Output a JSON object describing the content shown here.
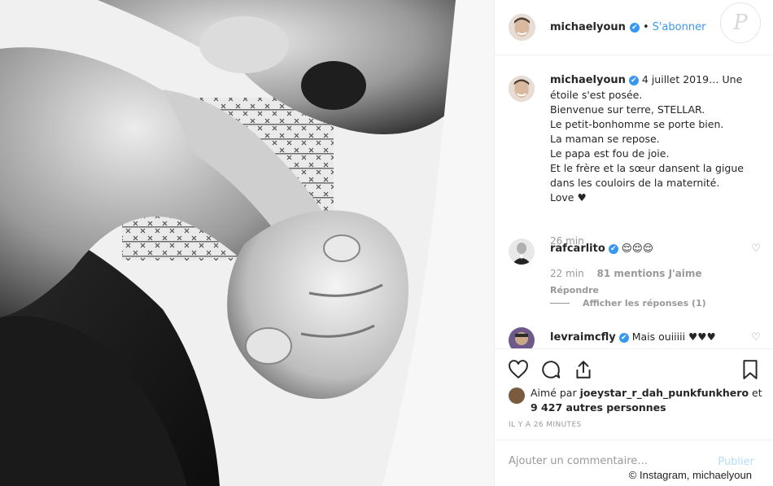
{
  "post": {
    "username": "michaelyoun",
    "follow_label": "S'abonner",
    "separator": "•",
    "verified_glyph": "✔",
    "watermark_letter": "P",
    "caption_lines": [
      "4 juillet 2019… Une",
      "étoile s'est posée.",
      "Bienvenue sur terre, STELLAR.",
      "Le petit-bonhomme se porte bien.",
      "La maman se repose.",
      "Le papa est fou de joie.",
      "Et le frère et la sœur dansent la gigue",
      "dans les couloirs de la maternité.",
      "Love ♥"
    ],
    "caption_time": "26 min"
  },
  "comments": [
    {
      "username": "rafcarlito",
      "text": "😌😌😌",
      "time": "22 min",
      "likes": "81 mentions J'aime",
      "reply_label": "Répondre",
      "view_replies": "Afficher les réponses (1)"
    },
    {
      "username": "levraimcfly",
      "text": "Mais ouiiiii ♥♥♥"
    }
  ],
  "likes": {
    "prefix": "Aimé par",
    "user": "joeystar_r_dah_punkfunkhero",
    "conjunction": "et",
    "others": "9 427 autres personnes"
  },
  "timestamp": "IL Y A 26 MINUTES",
  "comment_box": {
    "placeholder": "Ajouter un commentaire…",
    "publish_label": "Publier"
  },
  "photo_credit": "© Instagram, michaelyoun",
  "icons": [
    "heart-icon",
    "comment-icon",
    "share-icon",
    "bookmark-icon"
  ],
  "colors": {
    "accent": "#3897f0",
    "muted": "#999999",
    "publish_disabled": "#b2dffc"
  }
}
